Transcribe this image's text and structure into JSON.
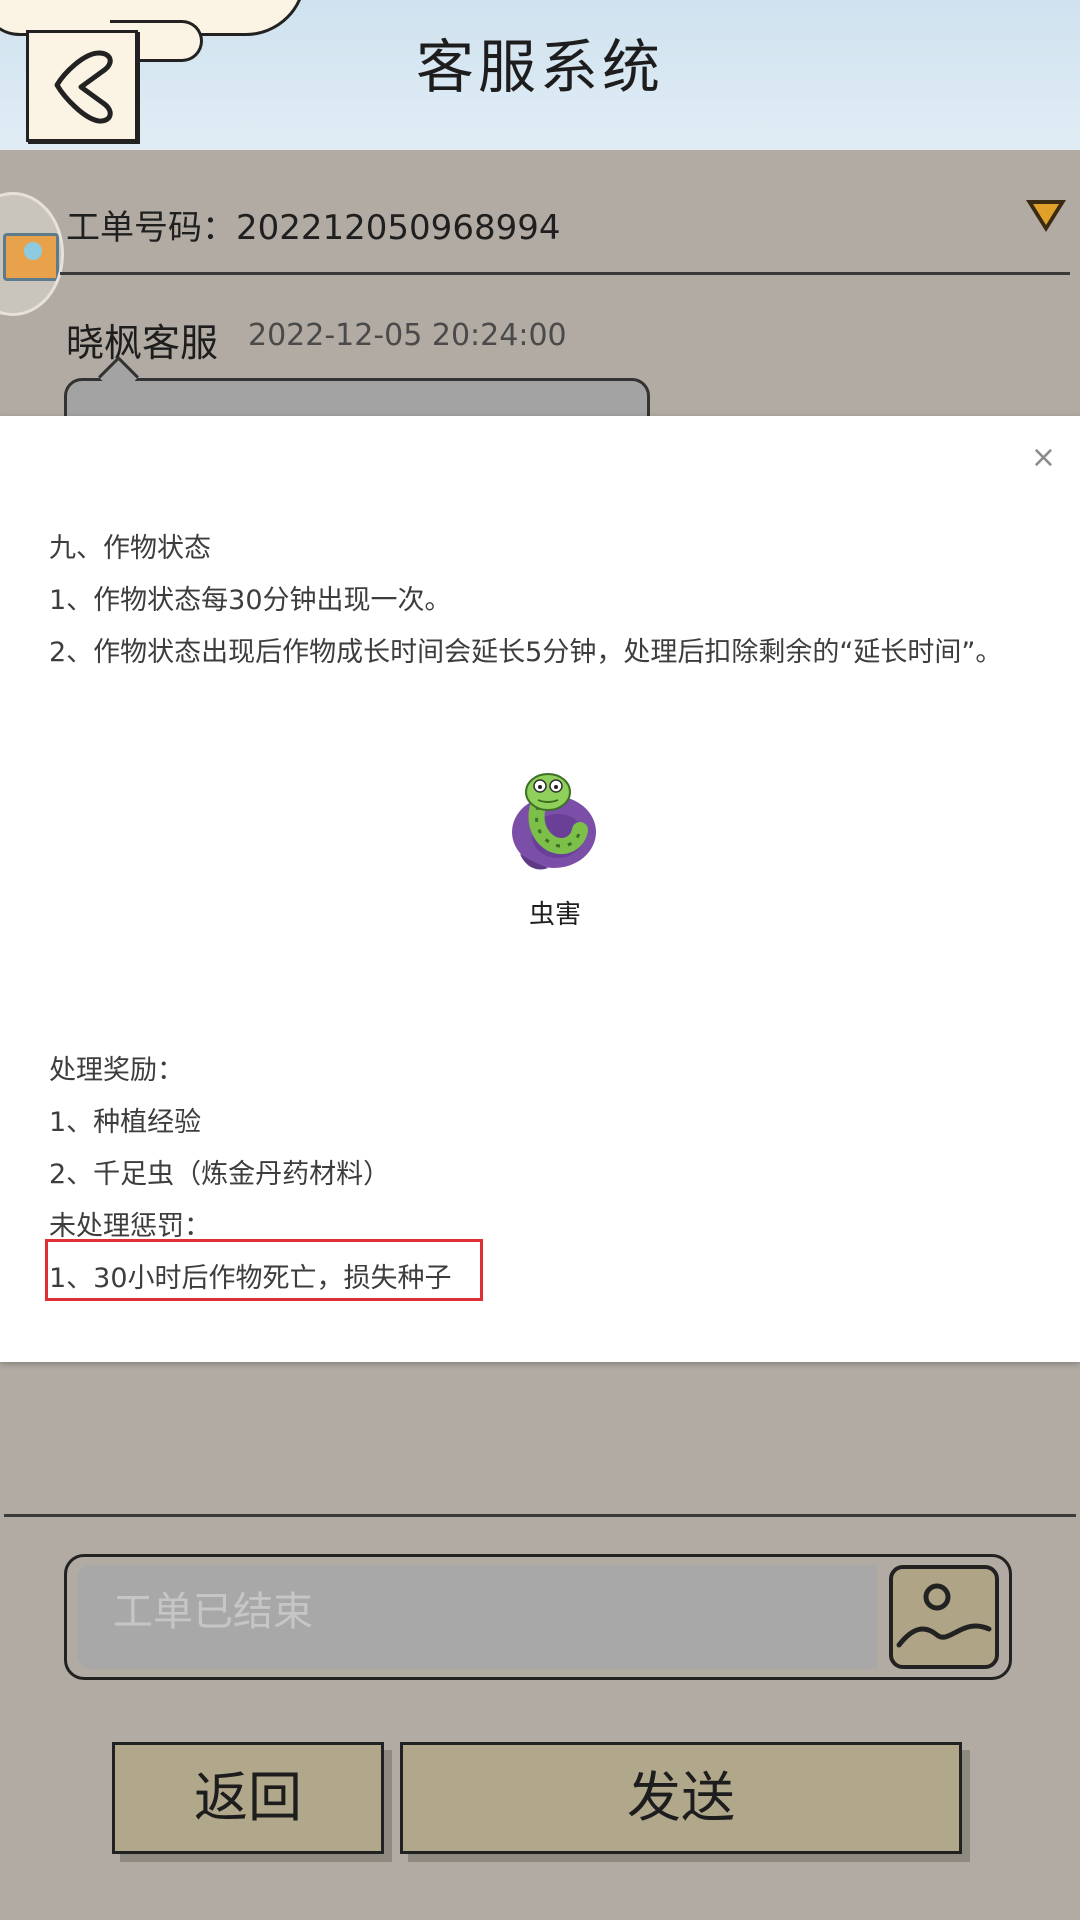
{
  "header": {
    "title": "客服系统"
  },
  "ticket": {
    "label": "工单号码：",
    "number": "202212050968994"
  },
  "message": {
    "sender": "晓枫客服",
    "timestamp": "2022-12-05 20:24:00"
  },
  "modal": {
    "close_glyph": "×",
    "section_title": "九、作物状态",
    "lines": [
      "1、作物状态每30分钟出现一次。",
      "2、作物状态出现后作物成长时间会延长5分钟，处理后扣除剩余的“延长时间”。"
    ],
    "icon": {
      "name": "worm-pest-icon",
      "label": "虫害"
    },
    "reward_title": "处理奖励：",
    "rewards": [
      "1、种植经验",
      "2、千足虫（炼金丹药材料）"
    ],
    "penalty_title": "未处理惩罚：",
    "penalties": [
      "1、30小时后作物死亡，损失种子"
    ]
  },
  "input": {
    "placeholder": "工单已结束"
  },
  "buttons": {
    "back": "返回",
    "send": "发送"
  },
  "colors": {
    "highlight": "#e03036",
    "button": "#b1a78a",
    "background": "#b1aba3"
  }
}
